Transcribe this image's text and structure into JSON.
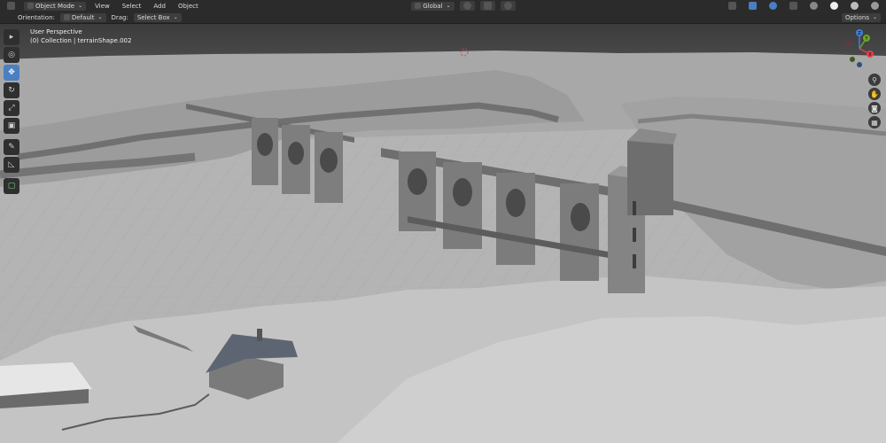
{
  "header": {
    "mode": "Object Mode",
    "menus": [
      "View",
      "Select",
      "Add",
      "Object"
    ],
    "transform": "Global"
  },
  "toolbar_header": {
    "orientation_label": "Orientation:",
    "orientation_value": "Default",
    "drag_label": "Drag:",
    "drag_value": "Select Box",
    "options": "Options"
  },
  "viewport": {
    "perspective": "User Perspective",
    "collection": "(0) Collection | terrainShape.002"
  },
  "gizmo": {
    "x": "X",
    "y": "Y",
    "z": "Z"
  },
  "colors": {
    "header_bg": "#2b2b2b",
    "accent": "#4a7fc1",
    "x_axis": "#e0404f",
    "y_axis": "#6ba528",
    "z_axis": "#3f7fd8"
  }
}
